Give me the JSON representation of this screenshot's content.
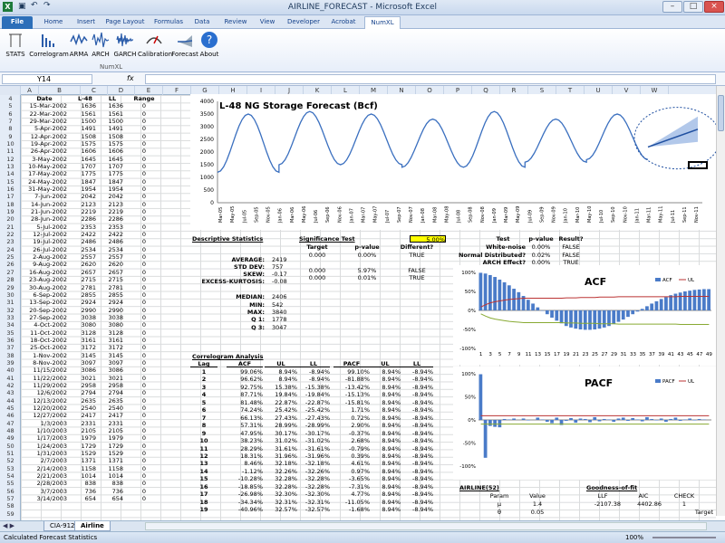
{
  "window": {
    "title": "AIRLINE_FORECAST - Microsoft Excel",
    "min": "–",
    "max": "□",
    "close": "×"
  },
  "tabs": [
    "File",
    "Home",
    "Insert",
    "Page Layout",
    "Formulas",
    "Data",
    "Review",
    "View",
    "Developer",
    "Acrobat",
    "NumXL"
  ],
  "ribbon": {
    "buttons": [
      "STATS",
      "Correlogram",
      "ARMA",
      "ARCH",
      "GARCH",
      "Calibration",
      "Forecast",
      "About"
    ],
    "group": "NumXL"
  },
  "formula": {
    "namebox": "Y14",
    "fx": "fx"
  },
  "columns": [
    "A",
    "B",
    "C",
    "D",
    "E",
    "F",
    "G",
    "H",
    "I",
    "J",
    "K",
    "L",
    "M",
    "N",
    "O",
    "P",
    "Q",
    "R",
    "S",
    "T",
    "U",
    "V",
    "W"
  ],
  "data_headers": {
    "date": "Date",
    "l48": "L-48",
    "ll": "LL",
    "range": "Range"
  },
  "rows": [
    [
      "15-Mar-2002",
      "1636",
      "1636",
      "0"
    ],
    [
      "22-Mar-2002",
      "1561",
      "1561",
      "0"
    ],
    [
      "29-Mar-2002",
      "1500",
      "1500",
      "0"
    ],
    [
      "5-Apr-2002",
      "1491",
      "1491",
      "0"
    ],
    [
      "12-Apr-2002",
      "1508",
      "1508",
      "0"
    ],
    [
      "19-Apr-2002",
      "1575",
      "1575",
      "0"
    ],
    [
      "26-Apr-2002",
      "1606",
      "1606",
      "0"
    ],
    [
      "3-May-2002",
      "1645",
      "1645",
      "0"
    ],
    [
      "10-May-2002",
      "1707",
      "1707",
      "0"
    ],
    [
      "17-May-2002",
      "1775",
      "1775",
      "0"
    ],
    [
      "24-May-2002",
      "1847",
      "1847",
      "0"
    ],
    [
      "31-May-2002",
      "1954",
      "1954",
      "0"
    ],
    [
      "7-Jun-2002",
      "2042",
      "2042",
      "0"
    ],
    [
      "14-Jun-2002",
      "2123",
      "2123",
      "0"
    ],
    [
      "21-Jun-2002",
      "2219",
      "2219",
      "0"
    ],
    [
      "28-Jun-2002",
      "2286",
      "2286",
      "0"
    ],
    [
      "5-Jul-2002",
      "2353",
      "2353",
      "0"
    ],
    [
      "12-Jul-2002",
      "2422",
      "2422",
      "0"
    ],
    [
      "19-Jul-2002",
      "2486",
      "2486",
      "0"
    ],
    [
      "26-Jul-2002",
      "2534",
      "2534",
      "0"
    ],
    [
      "2-Aug-2002",
      "2557",
      "2557",
      "0"
    ],
    [
      "9-Aug-2002",
      "2620",
      "2620",
      "0"
    ],
    [
      "16-Aug-2002",
      "2657",
      "2657",
      "0"
    ],
    [
      "23-Aug-2002",
      "2715",
      "2715",
      "0"
    ],
    [
      "30-Aug-2002",
      "2781",
      "2781",
      "0"
    ],
    [
      "6-Sep-2002",
      "2855",
      "2855",
      "0"
    ],
    [
      "13-Sep-2002",
      "2924",
      "2924",
      "0"
    ],
    [
      "20-Sep-2002",
      "2990",
      "2990",
      "0"
    ],
    [
      "27-Sep-2002",
      "3038",
      "3038",
      "0"
    ],
    [
      "4-Oct-2002",
      "3080",
      "3080",
      "0"
    ],
    [
      "11-Oct-2002",
      "3128",
      "3128",
      "0"
    ],
    [
      "18-Oct-2002",
      "3161",
      "3161",
      "0"
    ],
    [
      "25-Oct-2002",
      "3172",
      "3172",
      "0"
    ],
    [
      "1-Nov-2002",
      "3145",
      "3145",
      "0"
    ],
    [
      "8-Nov-2002",
      "3097",
      "3097",
      "0"
    ],
    [
      "11/15/2002",
      "3086",
      "3086",
      "0"
    ],
    [
      "11/22/2002",
      "3021",
      "3021",
      "0"
    ],
    [
      "11/29/2002",
      "2958",
      "2958",
      "0"
    ],
    [
      "12/6/2002",
      "2794",
      "2794",
      "0"
    ],
    [
      "12/13/2002",
      "2635",
      "2635",
      "0"
    ],
    [
      "12/20/2002",
      "2540",
      "2540",
      "0"
    ],
    [
      "12/27/2002",
      "2417",
      "2417",
      "0"
    ],
    [
      "1/3/2003",
      "2331",
      "2331",
      "0"
    ],
    [
      "1/10/2003",
      "2105",
      "2105",
      "0"
    ],
    [
      "1/17/2003",
      "1979",
      "1979",
      "0"
    ],
    [
      "1/24/2003",
      "1729",
      "1729",
      "0"
    ],
    [
      "1/31/2003",
      "1529",
      "1529",
      "0"
    ],
    [
      "2/7/2003",
      "1371",
      "1371",
      "0"
    ],
    [
      "2/14/2003",
      "1158",
      "1158",
      "0"
    ],
    [
      "2/21/2003",
      "1014",
      "1014",
      "0"
    ],
    [
      "2/28/2003",
      "838",
      "838",
      "0"
    ],
    [
      "3/7/2003",
      "736",
      "736",
      "0"
    ],
    [
      "3/14/2003",
      "654",
      "654",
      "0"
    ]
  ],
  "desc": {
    "title": "Descriptive Statistics",
    "labels": [
      "AVERAGE:",
      "STD DEV:",
      "SKEW:",
      "EXCESS-KURTOSIS:",
      "MEDIAN:",
      "MIN:",
      "MAX:",
      "Q 1:",
      "Q 3:"
    ],
    "values": [
      "2419",
      "757",
      "-0.17",
      "-0.08",
      "2406",
      "542",
      "3840",
      "1778",
      "3047"
    ]
  },
  "sig": {
    "title": "Significance Test",
    "level": "5.00%",
    "headers": [
      "Target",
      "p-value",
      "Different?"
    ],
    "rows": [
      [
        "0.000",
        "0.00%",
        "TRUE"
      ],
      [
        "0.000",
        "5.97%",
        "FALSE"
      ],
      [
        "0.000",
        "0.01%",
        "TRUE"
      ]
    ]
  },
  "tests": {
    "headers": [
      "Test",
      "p-value",
      "Result?"
    ],
    "rows": [
      [
        "White-noise",
        "0.00%",
        "FALSE"
      ],
      [
        "Normal Distributed?",
        "0.02%",
        "FALSE"
      ],
      [
        "ARCH Effect?",
        "0.00%",
        "TRUE"
      ]
    ]
  },
  "corr": {
    "title": "Correlogram Analysis",
    "headers": [
      "Lag",
      "ACF",
      "UL",
      "LL",
      "PACF",
      "UL",
      "LL"
    ],
    "rows": [
      [
        "1",
        "99.06%",
        "8.94%",
        "-8.94%",
        "99.10%",
        "8.94%",
        "-8.94%"
      ],
      [
        "2",
        "96.62%",
        "8.94%",
        "-8.94%",
        "-81.88%",
        "8.94%",
        "-8.94%"
      ],
      [
        "3",
        "92.75%",
        "15.38%",
        "-15.38%",
        "-13.42%",
        "8.94%",
        "-8.94%"
      ],
      [
        "4",
        "87.71%",
        "19.84%",
        "-19.84%",
        "-15.13%",
        "8.94%",
        "-8.94%"
      ],
      [
        "5",
        "81.48%",
        "22.87%",
        "-22.87%",
        "-15.81%",
        "8.94%",
        "-8.94%"
      ],
      [
        "6",
        "74.24%",
        "25.42%",
        "-25.42%",
        "1.71%",
        "8.94%",
        "-8.94%"
      ],
      [
        "7",
        "66.13%",
        "27.43%",
        "-27.43%",
        "0.72%",
        "8.94%",
        "-8.94%"
      ],
      [
        "8",
        "57.31%",
        "28.99%",
        "-28.99%",
        "2.90%",
        "8.94%",
        "-8.94%"
      ],
      [
        "9",
        "47.95%",
        "30.17%",
        "-30.17%",
        "-0.37%",
        "8.94%",
        "-8.94%"
      ],
      [
        "10",
        "38.23%",
        "31.02%",
        "-31.02%",
        "2.68%",
        "8.94%",
        "-8.94%"
      ],
      [
        "11",
        "28.29%",
        "31.61%",
        "-31.61%",
        "-0.79%",
        "8.94%",
        "-8.94%"
      ],
      [
        "12",
        "18.31%",
        "31.96%",
        "-31.96%",
        "0.39%",
        "8.94%",
        "-8.94%"
      ],
      [
        "13",
        "8.46%",
        "32.18%",
        "-32.18%",
        "4.61%",
        "8.94%",
        "-8.94%"
      ],
      [
        "14",
        "-1.12%",
        "32.26%",
        "-32.26%",
        "0.97%",
        "8.94%",
        "-8.94%"
      ],
      [
        "15",
        "-10.28%",
        "32.28%",
        "-32.28%",
        "-3.65%",
        "8.94%",
        "-8.94%"
      ],
      [
        "16",
        "-18.85%",
        "32.28%",
        "-32.28%",
        "-7.31%",
        "8.94%",
        "-8.94%"
      ],
      [
        "17",
        "-26.98%",
        "32.30%",
        "-32.30%",
        "4.77%",
        "8.94%",
        "-8.94%"
      ],
      [
        "18",
        "-34.34%",
        "32.31%",
        "-32.31%",
        "-11.05%",
        "8.94%",
        "-8.94%"
      ],
      [
        "19",
        "-40.96%",
        "32.57%",
        "-32.57%",
        "-1.68%",
        "8.94%",
        "-8.94%"
      ]
    ]
  },
  "airline": {
    "title": "AIRLINE(52)",
    "headers": [
      "Param",
      "Value"
    ],
    "rows": [
      [
        "μ",
        "1.4"
      ],
      [
        "θ",
        "0.05"
      ]
    ]
  },
  "gof": {
    "title": "Goodness-of-fit",
    "headers": [
      "LLF",
      "AIC",
      "CHECK"
    ],
    "values": [
      "-2107.38",
      "4402.86",
      "1"
    ],
    "target": "Target"
  },
  "sheets": {
    "tab1": "CIA-912",
    "tab2": "Airline"
  },
  "status": {
    "left": "Calculated Forecast Statistics",
    "zoom": "100%"
  },
  "chart_data": [
    {
      "type": "line",
      "title": "L-48 NG Storage Forecast (Bcf)",
      "ylim": [
        0,
        4000
      ],
      "yticks": [
        0,
        500,
        1000,
        1500,
        2000,
        2500,
        3000,
        3500,
        4000
      ],
      "xticks": [
        "Mar-05",
        "May-05",
        "Jul-05",
        "Sep-05",
        "Nov-05",
        "Jan-06",
        "Mar-06",
        "May-06",
        "Jul-06",
        "Sep-06",
        "Nov-06",
        "Jan-07",
        "Mar-07",
        "May-07",
        "Jul-07",
        "Sep-07",
        "Nov-07",
        "Jan-08",
        "Mar-08",
        "May-08",
        "Jul-08",
        "Sep-08",
        "Nov-08",
        "Jan-09",
        "Mar-09",
        "May-09",
        "Jul-09",
        "Sep-09",
        "Nov-09",
        "Jan-10",
        "Mar-10",
        "May-10",
        "Jul-10",
        "Sep-10",
        "Nov-10",
        "Jan-11",
        "Mar-11",
        "May-11",
        "Jul-11",
        "Sep-11",
        "Nov-11"
      ],
      "cycles": [
        {
          "trough": 1200,
          "peak": 3500
        },
        {
          "trough": 1500,
          "peak": 3600
        },
        {
          "trough": 1500,
          "peak": 3500
        },
        {
          "trough": 1400,
          "peak": 3300
        },
        {
          "trough": 1400,
          "peak": 3600
        },
        {
          "trough": 1600,
          "peak": 3300
        },
        {
          "trough": 1700,
          "peak": 3500
        }
      ],
      "forecast": {
        "start": 2200,
        "end": 2900,
        "band": 500
      }
    },
    {
      "type": "bar",
      "title": "ACF",
      "series": [
        {
          "name": "ACF"
        },
        {
          "name": "UL"
        }
      ],
      "ylim": [
        -100,
        100
      ],
      "yticks": [
        "100%",
        "50%",
        "0%",
        "-50%",
        "-100%"
      ],
      "xticks": [
        "1",
        "3",
        "5",
        "7",
        "9",
        "11",
        "13",
        "15",
        "17",
        "19",
        "21",
        "23",
        "25",
        "27",
        "29",
        "31",
        "33",
        "35",
        "37",
        "39",
        "41",
        "43",
        "45",
        "47",
        "49"
      ],
      "values": [
        99,
        97,
        93,
        88,
        81,
        74,
        66,
        57,
        48,
        38,
        28,
        18,
        8,
        -1,
        -10,
        -19,
        -27,
        -34,
        -41,
        -45,
        -48,
        -50,
        -51,
        -51,
        -50,
        -48,
        -45,
        -41,
        -36,
        -30,
        -24,
        -17,
        -10,
        -3,
        4,
        11,
        18,
        24,
        30,
        35,
        40,
        44,
        47,
        50,
        52,
        54,
        55,
        56,
        56
      ],
      "ul": [
        9,
        15,
        20,
        23,
        25,
        27,
        29,
        30,
        31,
        32,
        32,
        32,
        32,
        32,
        32,
        32,
        32,
        32,
        33,
        33,
        33,
        34,
        34,
        34,
        34,
        35,
        35,
        35,
        35,
        36,
        36,
        36,
        36,
        36,
        36,
        36,
        36,
        36,
        36,
        36,
        36,
        36,
        37,
        37,
        37,
        37,
        37,
        37,
        37
      ]
    },
    {
      "type": "bar",
      "title": "PACF",
      "series": [
        {
          "name": "PACF"
        },
        {
          "name": "UL"
        }
      ],
      "ylim": [
        -100,
        100
      ],
      "yticks": [
        "100%",
        "50%",
        "0%",
        "-50%",
        "-100%"
      ],
      "values": [
        99,
        -82,
        -13,
        -15,
        -16,
        2,
        1,
        3,
        0,
        3,
        -1,
        0,
        5,
        1,
        -4,
        -7,
        5,
        -11,
        -2,
        4,
        -6,
        3,
        2,
        -5,
        6,
        -3,
        2,
        1,
        -4,
        3,
        5,
        -2,
        4,
        1,
        -3,
        6,
        2,
        -1,
        3,
        -4,
        2,
        5,
        -2,
        1,
        3,
        -1,
        2,
        1,
        0
      ],
      "ul": [
        9
      ]
    }
  ]
}
